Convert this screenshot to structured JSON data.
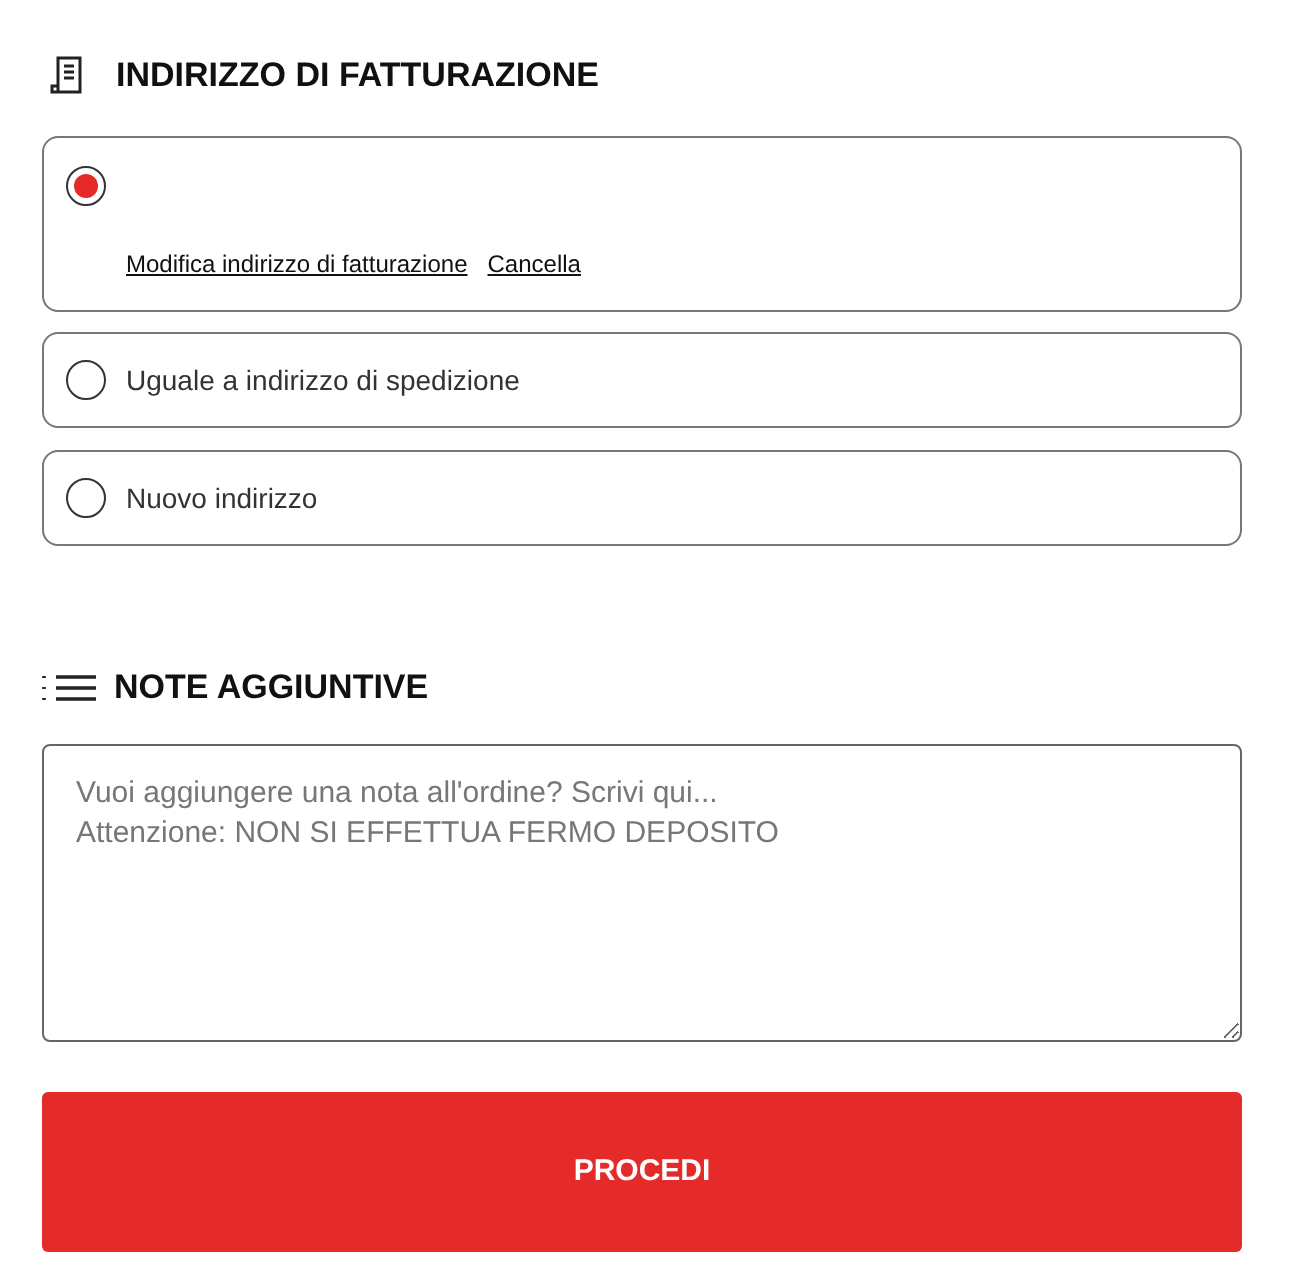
{
  "billing": {
    "title": "INDIRIZZO DI FATTURAZIONE",
    "options": [
      {
        "selected": true,
        "links": [
          "Modifica indirizzo di fatturazione",
          "Cancella"
        ]
      },
      {
        "label": "Uguale a indirizzo di spedizione",
        "selected": false
      },
      {
        "label": "Nuovo indirizzo",
        "selected": false
      }
    ]
  },
  "notes": {
    "title": "NOTE AGGIUNTIVE",
    "placeholder": "Vuoi aggiungere una nota all'ordine? Scrivi qui...\nAttenzione: NON SI EFFETTUA FERMO DEPOSITO"
  },
  "submit": {
    "label": "PROCEDI"
  }
}
